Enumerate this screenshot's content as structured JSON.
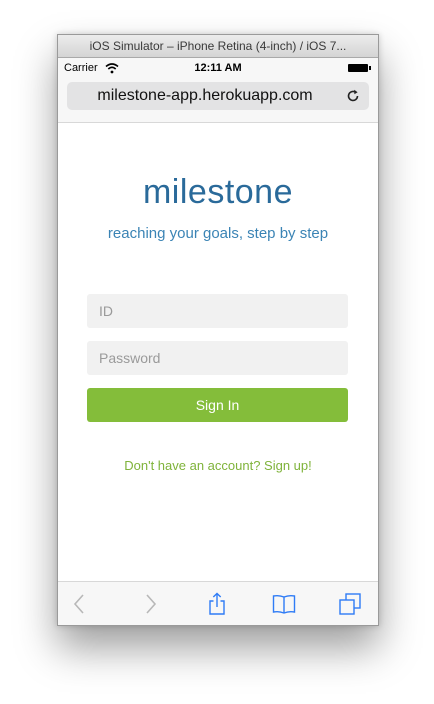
{
  "window": {
    "title": "iOS Simulator – iPhone Retina (4-inch) / iOS 7..."
  },
  "status_bar": {
    "carrier": "Carrier",
    "time": "12:11 AM"
  },
  "browser": {
    "url": "milestone-app.herokuapp.com"
  },
  "page": {
    "brand": "milestone",
    "tagline": "reaching your goals, step by step",
    "id_placeholder": "ID",
    "password_placeholder": "Password",
    "signin_label": "Sign In",
    "signup_link": "Don't have an account? Sign up!"
  },
  "colors": {
    "brand": "#2a6a9a",
    "signin_button": "#84bd3a",
    "link": "#7fb33a",
    "toolbar_icon_active": "#2f7cf6",
    "toolbar_icon_disabled": "#b8b8b8"
  },
  "toolbar": {
    "icons": [
      "back-icon",
      "forward-icon",
      "share-icon",
      "bookmarks-icon",
      "tabs-icon"
    ]
  }
}
